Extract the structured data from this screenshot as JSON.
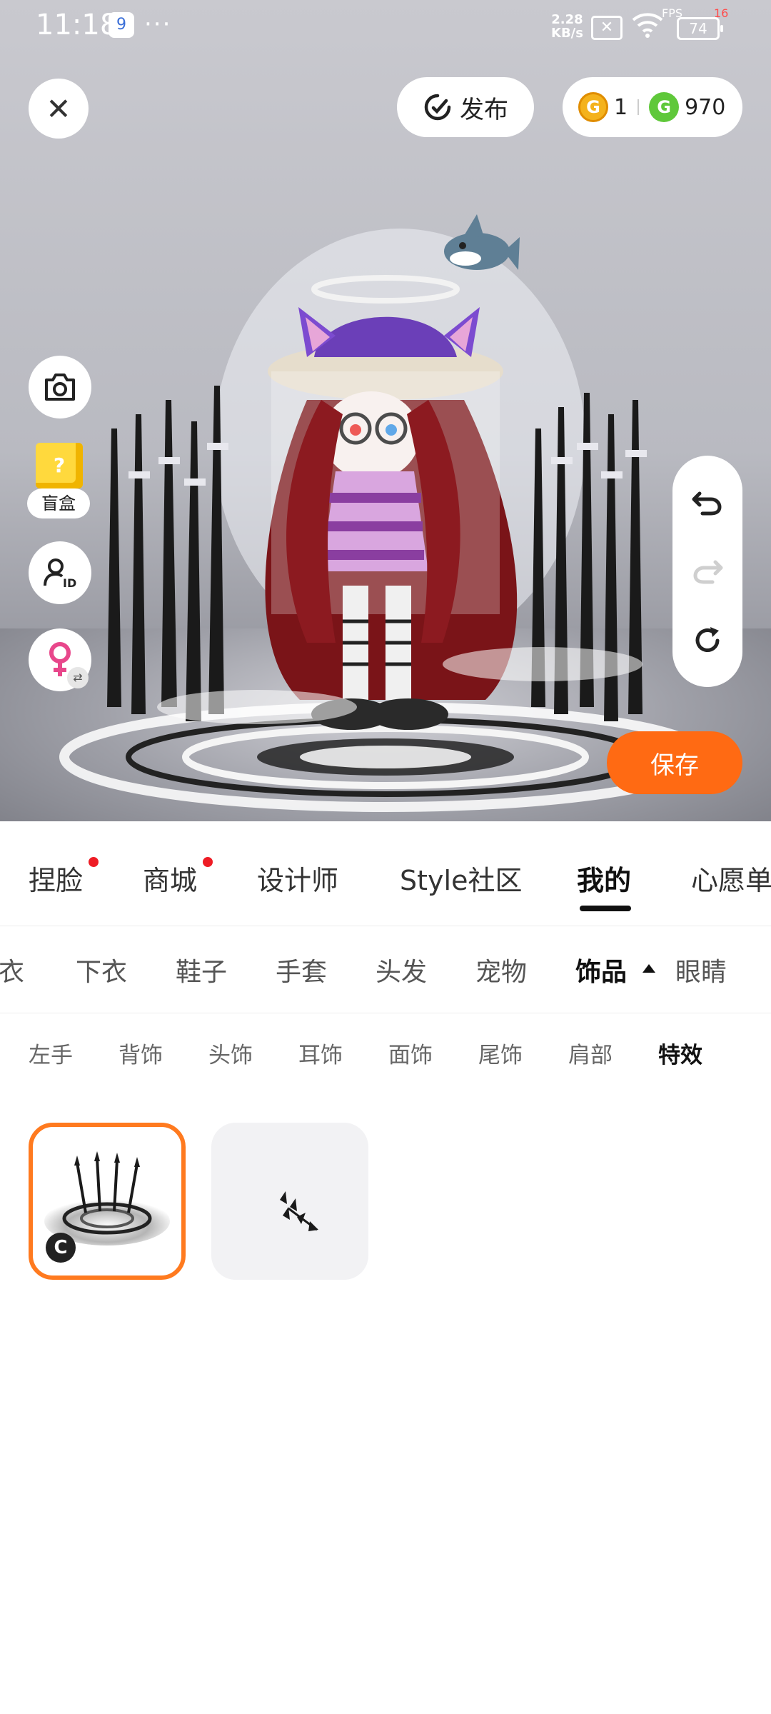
{
  "status_bar": {
    "time": "11:18",
    "app_badge": "9",
    "more": "···",
    "net_speed_value": "2.28",
    "net_speed_unit": "KB/s",
    "fps_label": "FPS",
    "fps_value": "16",
    "battery": "74"
  },
  "top_bar": {
    "publish_label": "发布",
    "gold_coins": "1",
    "green_coins": "970"
  },
  "left_tools": {
    "blind_box_label": "盲盒"
  },
  "actions": {
    "save_label": "保存"
  },
  "tabs_primary": [
    {
      "label": "捏脸",
      "dot": true
    },
    {
      "label": "商城",
      "dot": true
    },
    {
      "label": "设计师",
      "dot": false
    },
    {
      "label": "Style社区",
      "dot": false
    },
    {
      "label": "我的",
      "dot": false,
      "active": true
    },
    {
      "label": "心愿单",
      "dot": false
    }
  ],
  "tabs_category": [
    {
      "label": "上衣"
    },
    {
      "label": "下衣"
    },
    {
      "label": "鞋子"
    },
    {
      "label": "手套"
    },
    {
      "label": "头发"
    },
    {
      "label": "宠物"
    },
    {
      "label": "饰品",
      "active": true
    },
    {
      "label": "眼睛"
    }
  ],
  "tabs_sub": [
    {
      "label": "左手"
    },
    {
      "label": "背饰"
    },
    {
      "label": "头饰"
    },
    {
      "label": "耳饰"
    },
    {
      "label": "面饰"
    },
    {
      "label": "尾饰"
    },
    {
      "label": "肩部"
    },
    {
      "label": "特效",
      "active": true
    }
  ],
  "items": [
    {
      "name": "effect-item-1",
      "selected": true,
      "badge": "C"
    },
    {
      "name": "effect-item-2",
      "selected": false
    }
  ],
  "colors": {
    "accent": "#ff6a13",
    "selected_border": "#ff7a1f",
    "notification_dot": "#ee1c25",
    "gold_coin": "#f4b21c",
    "green_coin": "#5fc83a",
    "gender_icon": "#e8478b"
  }
}
